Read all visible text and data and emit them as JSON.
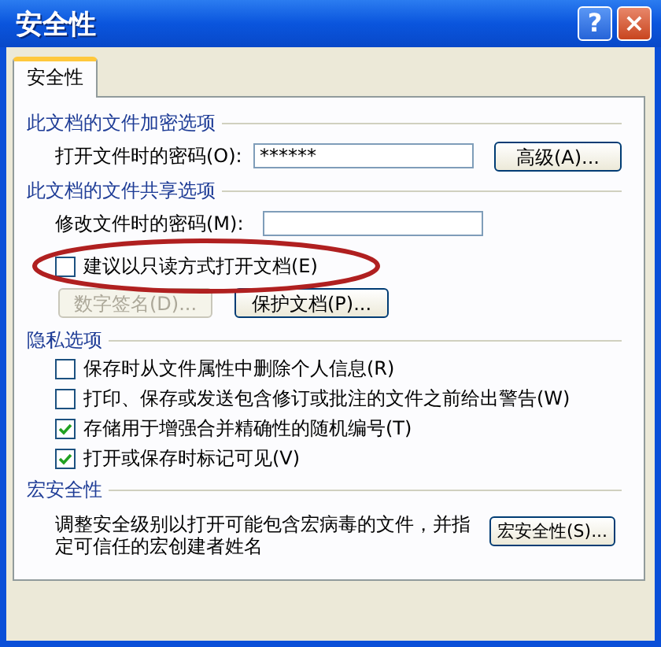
{
  "window": {
    "title": "安全性"
  },
  "title_buttons": [
    {
      "kind": "help",
      "label": "?"
    },
    {
      "kind": "close",
      "label": "×"
    }
  ],
  "tabs": [
    {
      "label": "安全性",
      "selected": true
    }
  ],
  "encryption": {
    "heading": "此文档的文件加密选项",
    "label": "打开文件时的密码(O):",
    "value": "******",
    "button": "高级(A)..."
  },
  "sharing": {
    "heading": "此文档的文件共享选项",
    "label": "修改文件时的密码(M):",
    "checkbox": {
      "label": "建议以只读方式打开文档(E)",
      "checked": false,
      "highlighted": true
    },
    "buttons": [
      {
        "label": "数字签名(D)...",
        "disabled": true
      },
      {
        "label": "保护文档(P)...",
        "disabled": false
      }
    ]
  },
  "privacy": {
    "heading": "隐私选项",
    "options": [
      {
        "label": "保存时从文件属性中删除个人信息(R)",
        "checked": false
      },
      {
        "label": "打印、保存或发送包含修订或批注的文件之前给出警告(W)",
        "checked": false
      },
      {
        "label": "存储用于增强合并精确性的随机编号(T)",
        "checked": true
      },
      {
        "label": "打开或保存时标记可见(V)",
        "checked": true
      }
    ]
  },
  "macro": {
    "heading": "宏安全性",
    "description": "调整安全级别以打开可能包含宏病毒的文件，并指定可信任的宏创建者姓名",
    "button": "宏安全性(S)..."
  }
}
